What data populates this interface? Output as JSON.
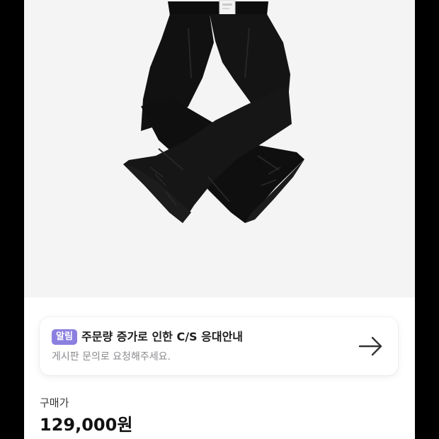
{
  "product": {
    "image_alt_icon": "black-flared-pants-image"
  },
  "notice": {
    "badge": "알림",
    "title": "주문량 증가로 인한 C/S 응대안내",
    "subtitle": "게시판 문의로 요청해주세요.",
    "arrow_icon": "arrow-right-icon",
    "badge_color": "#8b7fe0"
  },
  "purchase": {
    "label": "구매가",
    "price": "129,000원"
  }
}
